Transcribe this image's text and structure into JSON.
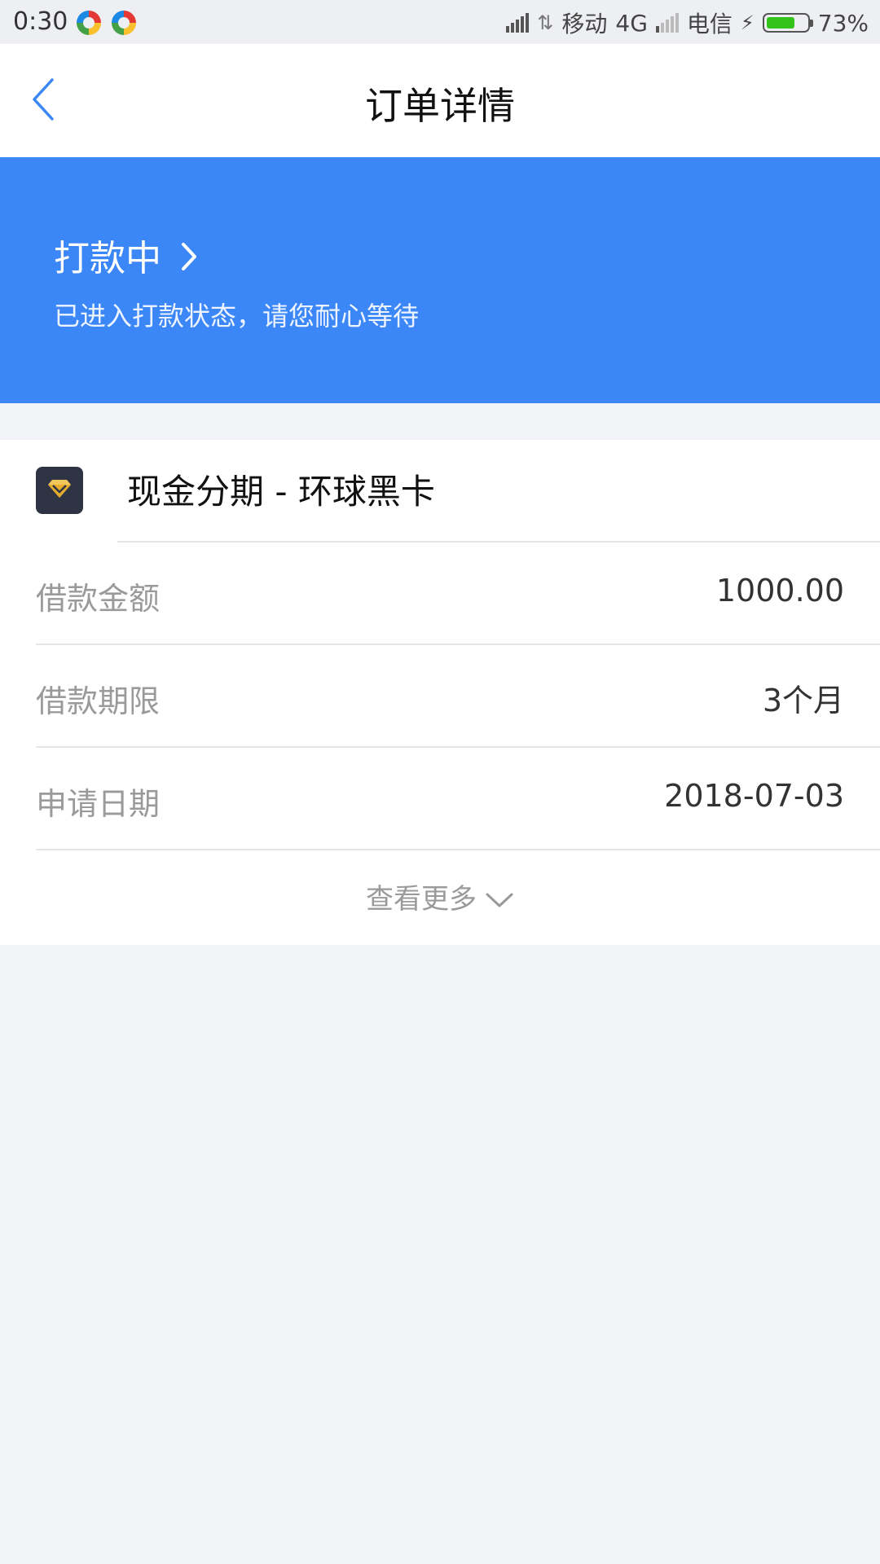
{
  "status_bar": {
    "time": "0:30",
    "carrier1": "移动",
    "network": "4G",
    "carrier2": "电信",
    "battery": "73%",
    "battery_level": 0.73,
    "battery_color": "#33c21a"
  },
  "nav": {
    "title": "订单详情",
    "back_icon": "chevron-left-icon"
  },
  "banner": {
    "status": "打款中",
    "description": "已进入打款状态，请您耐心等待",
    "background": "#3c87f8"
  },
  "product": {
    "name": "现金分期 - 环球黑卡",
    "icon": "diamond-icon"
  },
  "details": [
    {
      "label": "借款金额",
      "value": "1000.00"
    },
    {
      "label": "借款期限",
      "value": "3个月"
    },
    {
      "label": "申请日期",
      "value": "2018-07-03"
    }
  ],
  "more": {
    "label": "查看更多",
    "icon": "chevron-down-icon"
  }
}
